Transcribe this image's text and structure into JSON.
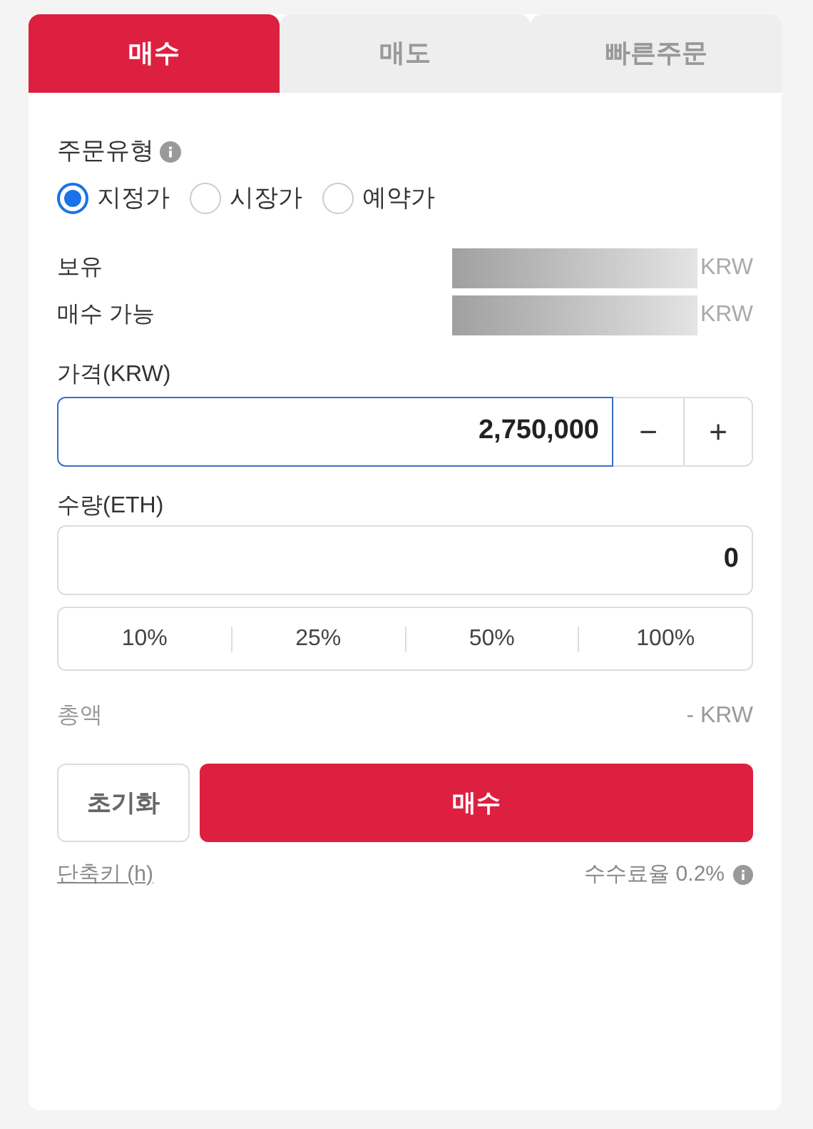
{
  "tabs": [
    {
      "label": "매수",
      "selected": true
    },
    {
      "label": "매도",
      "selected": false
    },
    {
      "label": "빠른주문",
      "selected": false
    }
  ],
  "order_type": {
    "label": "주문유형",
    "options": [
      {
        "label": "지정가",
        "selected": true
      },
      {
        "label": "시장가",
        "selected": false
      },
      {
        "label": "예약가",
        "selected": false
      }
    ]
  },
  "balances": [
    {
      "label": "보유",
      "unit": "KRW"
    },
    {
      "label": "매수 가능",
      "unit": "KRW"
    }
  ],
  "price": {
    "label": "가격(KRW)",
    "value": "2,750,000",
    "minus": "−",
    "plus": "+"
  },
  "quantity": {
    "label": "수량(ETH)",
    "value": "0"
  },
  "percent_buttons": [
    "10%",
    "25%",
    "50%",
    "100%"
  ],
  "total": {
    "label": "총액",
    "value": "- KRW"
  },
  "buttons": {
    "reset": "초기화",
    "submit": "매수"
  },
  "shortcut_link": "단축키 (h)",
  "fee": "수수료율 0.2%"
}
